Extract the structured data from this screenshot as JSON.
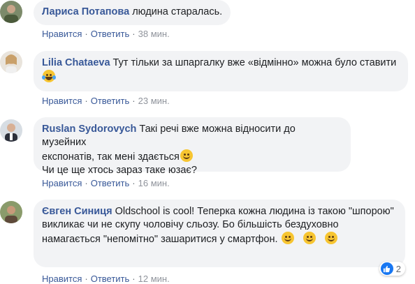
{
  "actions": {
    "like": "Нравится",
    "reply": "Ответить",
    "sep": "·"
  },
  "comments": [
    {
      "author": "Лариса Потапова",
      "text": "людина старалась.",
      "time": "38 мин."
    },
    {
      "author": "Lilia Chataeva",
      "text": "Тут тільки за шпаргалку вже «відмінно» можна було ставити",
      "emoji": "laughing-tears",
      "time": "23 мин."
    },
    {
      "author": "Ruslan Sydorovych",
      "text_line1": "Такі речі вже можна відносити до музейних",
      "text_line2": "експонатів, так мені здається",
      "text_line3": "Чи це ще хтось зараз таке юзає?",
      "emoji": "smile",
      "time": "16 мин."
    },
    {
      "author": "Євген Синиця",
      "text": "Oldschool is cool! Теперка кожна людина із такою \"шпорою\" викликає чи не скупу чоловічу сльозу. Бо більшість бездуховно намагається \"непомітно\" зашаритися у смартфон.",
      "emoji": "smile",
      "time": "12 мин.",
      "reactions": {
        "icon": "like-icon",
        "count": "2"
      }
    }
  ],
  "colors": {
    "author": "#385898",
    "bubble": "#f2f3f5",
    "meta": "#606770"
  }
}
